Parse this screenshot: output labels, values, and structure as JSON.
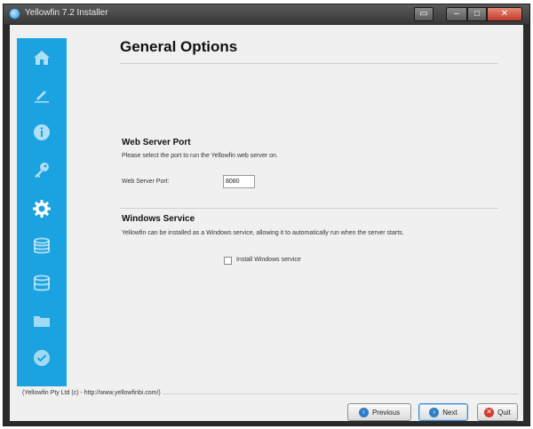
{
  "window": {
    "title": "Yellowfin 7.2 Installer"
  },
  "sidebar": {
    "items": [
      {
        "icon": "home-icon"
      },
      {
        "icon": "pen-icon"
      },
      {
        "icon": "info-icon"
      },
      {
        "icon": "key-icon"
      },
      {
        "icon": "gear-icon",
        "active": true
      },
      {
        "icon": "database-icon"
      },
      {
        "icon": "database-sync-icon"
      },
      {
        "icon": "folder-icon"
      },
      {
        "icon": "check-icon"
      }
    ],
    "color": "#1aa3e0"
  },
  "main": {
    "title": "General Options",
    "web_server": {
      "heading": "Web Server Port",
      "description": "Please select the port to run the Yellowfin web server on.",
      "port_label": "Web Server Port:",
      "port_value": "8080"
    },
    "windows_service": {
      "heading": "Windows Service",
      "description": "Yellowfin can be installed as a Windows service, allowing it to automatically run when the server starts.",
      "checkbox_label": "Install Windows service",
      "checked": false
    }
  },
  "footer": {
    "copyright": "(Yellowfin Pty Ltd (c) - http://www.yellowfinbi.com/)",
    "buttons": {
      "previous": "Previous",
      "next": "Next",
      "quit": "Quit"
    }
  },
  "colors": {
    "accent": "#1aa3e0",
    "next_icon": "#2f7fc8",
    "quit_icon": "#d23a2b"
  }
}
